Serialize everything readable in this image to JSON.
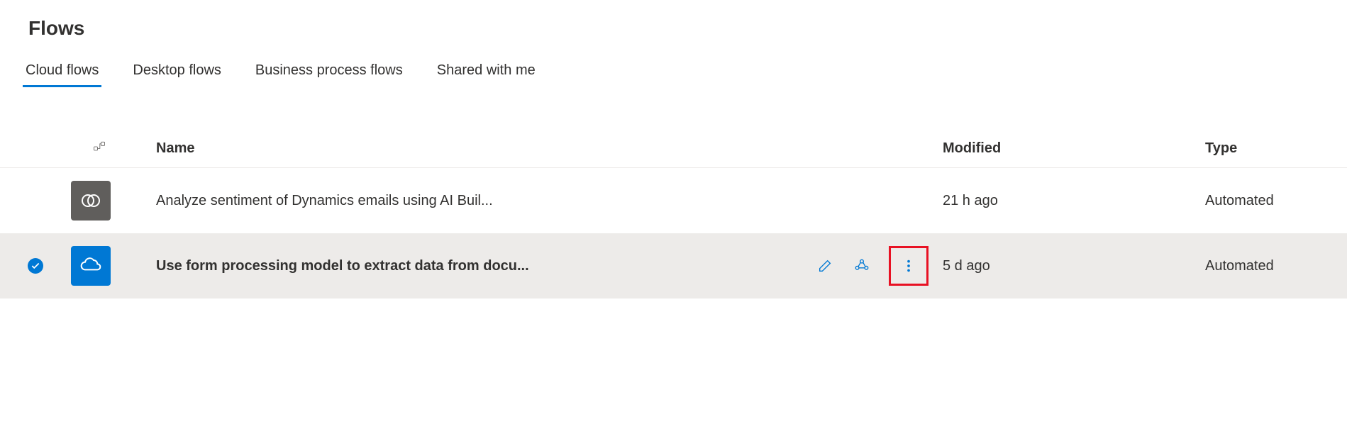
{
  "page": {
    "title": "Flows"
  },
  "tabs": [
    {
      "label": "Cloud flows",
      "active": true
    },
    {
      "label": "Desktop flows",
      "active": false
    },
    {
      "label": "Business process flows",
      "active": false
    },
    {
      "label": "Shared with me",
      "active": false
    }
  ],
  "columns": {
    "name": "Name",
    "modified": "Modified",
    "type": "Type"
  },
  "rows": [
    {
      "selected": false,
      "icon": "dynamics-icon",
      "icon_color": "gray",
      "name": "Analyze sentiment of Dynamics emails using AI Buil...",
      "modified": "21 h ago",
      "type": "Automated",
      "show_actions": false
    },
    {
      "selected": true,
      "icon": "onedrive-icon",
      "icon_color": "blue",
      "name": "Use form processing model to extract data from docu...",
      "modified": "5 d ago",
      "type": "Automated",
      "show_actions": true
    }
  ]
}
